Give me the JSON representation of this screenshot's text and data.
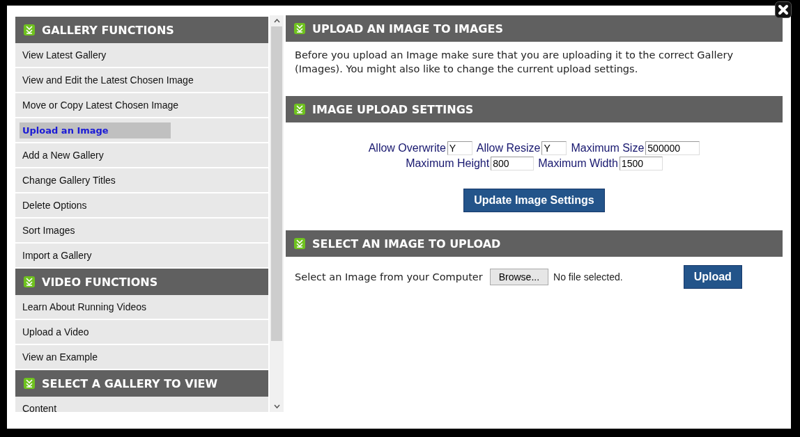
{
  "sidebar": {
    "sections": [
      {
        "title": "GALLERY FUNCTIONS",
        "items": [
          {
            "label": "View Latest Gallery",
            "selected": false
          },
          {
            "label": "View and Edit the Latest Chosen Image",
            "selected": false
          },
          {
            "label": "Move or Copy Latest Chosen Image",
            "selected": false
          },
          {
            "label": "Upload an Image",
            "selected": true
          },
          {
            "label": "Add a New Gallery",
            "selected": false
          },
          {
            "label": "Change Gallery Titles",
            "selected": false
          },
          {
            "label": "Delete Options",
            "selected": false
          },
          {
            "label": "Sort Images",
            "selected": false
          },
          {
            "label": "Import a Gallery",
            "selected": false
          }
        ]
      },
      {
        "title": "VIDEO FUNCTIONS",
        "items": [
          {
            "label": "Learn About Running Videos",
            "selected": false
          },
          {
            "label": "Upload a Video",
            "selected": false
          },
          {
            "label": "View an Example",
            "selected": false
          }
        ]
      },
      {
        "title": "SELECT A GALLERY TO VIEW",
        "items": [
          {
            "label": "Content",
            "selected": false
          }
        ]
      }
    ]
  },
  "main": {
    "upload_section": {
      "title": "UPLOAD AN IMAGE TO IMAGES",
      "text": "Before you upload an Image make sure that you are uploading it to the correct Gallery (Images). You might also like to change the current upload settings."
    },
    "settings_section": {
      "title": "IMAGE UPLOAD SETTINGS",
      "field_rows": [
        [
          {
            "label": "Allow Overwrite",
            "value": "Y"
          },
          {
            "label": "Allow Resize",
            "value": "Y"
          },
          {
            "label": "Maximum Size",
            "value": "500000"
          }
        ],
        [
          {
            "label": "Maximum Height",
            "value": "800"
          },
          {
            "label": "Maximum Width",
            "value": "1500"
          }
        ]
      ],
      "button": "Update Image Settings"
    },
    "select_section": {
      "title": "SELECT AN IMAGE TO UPLOAD",
      "prompt": "Select an Image from your Computer",
      "browse_button": "Browse...",
      "file_status": "No file selected.",
      "upload_button": "Upload"
    }
  }
}
